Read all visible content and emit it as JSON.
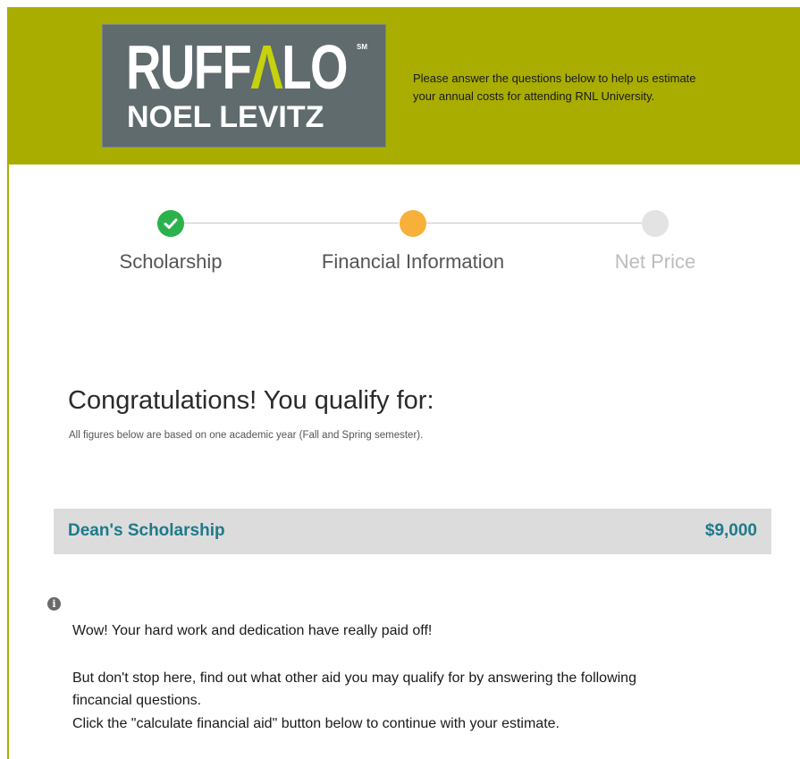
{
  "header": {
    "logo": {
      "line1_a": "RUFF",
      "line1_b": "Λ",
      "line1_c": "LO",
      "sm": "SM",
      "line2": "NOEL LEVITZ"
    },
    "intro_line1": "Please answer the questions below to help us estimate",
    "intro_line2": "your annual costs for attending RNL University.",
    "background_color": "#a8ad00"
  },
  "stepper": {
    "steps": [
      {
        "label": "Scholarship",
        "state": "complete",
        "color": "#2bb24c",
        "icon": "check-icon"
      },
      {
        "label": "Financial Information",
        "state": "current",
        "color": "#f7b03a"
      },
      {
        "label": "Net Price",
        "state": "upcoming",
        "color": "#e3e3e3"
      }
    ]
  },
  "main": {
    "heading": "Congratulations! You qualify for:",
    "subnote": "All figures below are based on one academic year (Fall and Spring semester).",
    "award": {
      "name": "Dean's Scholarship",
      "amount": "$9,000",
      "color": "#1d7a8a"
    },
    "info_icon": "info-icon",
    "message": {
      "line1": "Wow! Your hard work and dedication have really paid off!",
      "line2": "But don't stop here, find out what other aid you may qualify for by answering the following",
      "line3": "fincancial questions.",
      "line4": "Click the \"calculate financial aid\" button below to continue with your estimate."
    }
  }
}
